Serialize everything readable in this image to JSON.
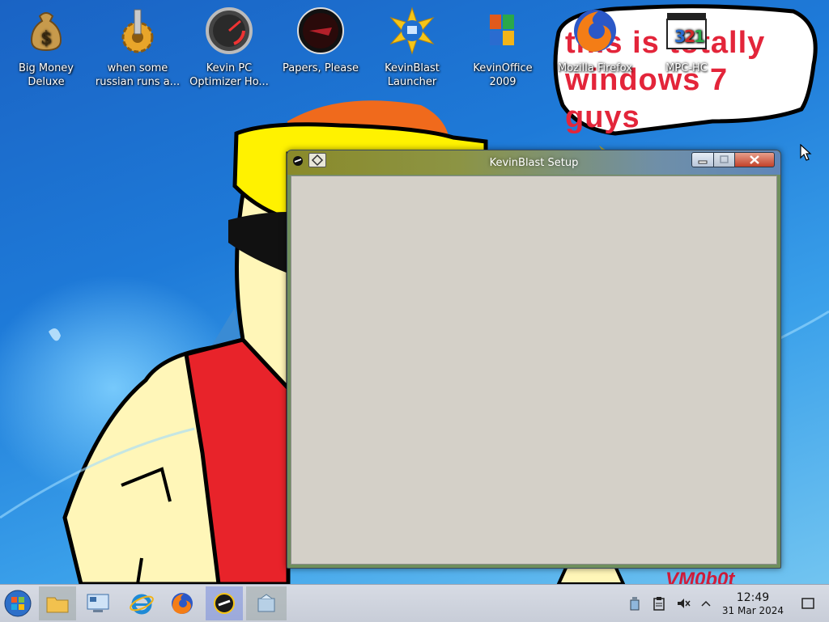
{
  "desktop_icons": [
    {
      "label_line1": "Big Money",
      "label_line2": "Deluxe",
      "icon": "money-bag-icon"
    },
    {
      "label_line1": "when some",
      "label_line2": "russian runs a...",
      "icon": "gear-drill-icon"
    },
    {
      "label_line1": "Kevin PC",
      "label_line2": "Optimizer Ho...",
      "icon": "speedometer-icon"
    },
    {
      "label_line1": "Papers, Please",
      "label_line2": "",
      "icon": "papers-please-icon"
    },
    {
      "label_line1": "KevinBlast",
      "label_line2": "Launcher",
      "icon": "kevinblast-star-icon"
    },
    {
      "label_line1": "KevinOffice",
      "label_line2": "2009",
      "icon": "office-logo-icon"
    },
    {
      "label_line1": "Mozilla Firefox",
      "label_line2": "",
      "icon": "firefox-icon"
    },
    {
      "label_line1": "MPC-HC",
      "label_line2": "",
      "icon": "mpc-hc-icon"
    }
  ],
  "wallpaper": {
    "bubble_text": "this is totally windows 7 guys",
    "signature": "VM0b0t"
  },
  "window": {
    "title": "KevinBlast Setup",
    "client_color": "#d4d0c8"
  },
  "taskbar": {
    "items": [
      "start-orb-icon",
      "file-explorer-icon",
      "control-panel-icon",
      "internet-explorer-icon",
      "firefox-icon",
      "kevinblast-launcher-icon",
      "installer-icon"
    ],
    "clock": {
      "time": "12:49",
      "date": "31 Mar 2024"
    }
  },
  "colors": {
    "desktop_blue": "#1e7ad8",
    "bubble_text": "#e3253a",
    "taskbar": "#d0d5df"
  }
}
